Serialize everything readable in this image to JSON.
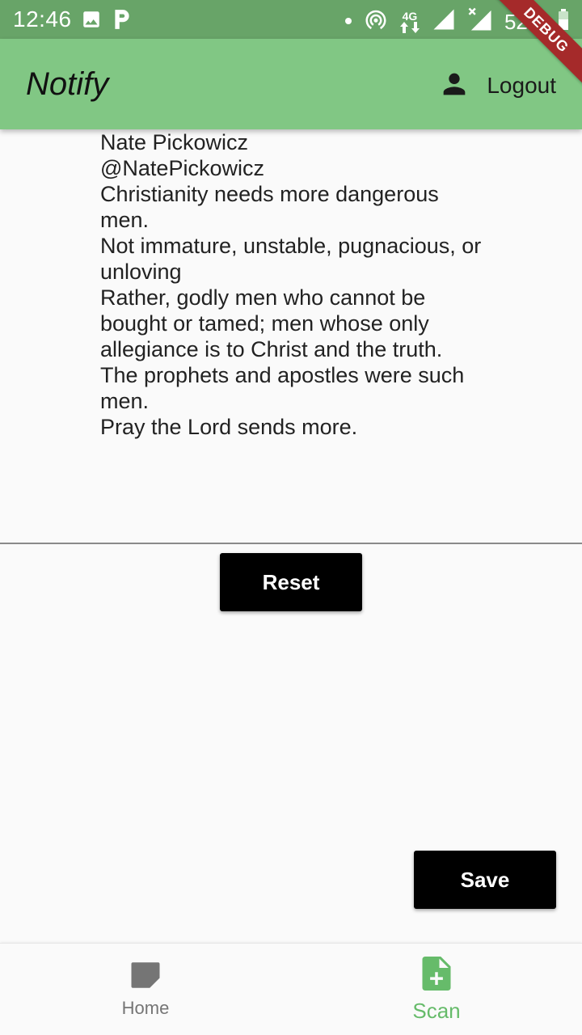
{
  "status_bar": {
    "time": "12:46",
    "network": "4G",
    "battery": "52%",
    "icons": [
      "image-icon",
      "parking-icon",
      "dot-icon",
      "hotspot-icon",
      "data-arrows-icon",
      "signal-icon",
      "signal-x-icon",
      "battery-icon"
    ]
  },
  "debug_banner": "DEBUG",
  "app_bar": {
    "title": "Notify",
    "logout_label": "Logout",
    "logout_icon": "person-icon"
  },
  "scan_result": {
    "lines": [
      "Nate Pickowicz",
      "@NatePickowicz",
      "Christianity needs more dangerous men.",
      "Not immature, unstable, pugnacious, or unloving",
      "Rather, godly men who cannot be bought or tamed; men whose only allegiance is to Christ and the truth.",
      "The prophets and apostles were such men.",
      "Pray the Lord sends more."
    ]
  },
  "actions": {
    "reset_label": "Reset",
    "save_label": "Save"
  },
  "bottom_nav": {
    "items": [
      {
        "label": "Home",
        "icon": "note-icon",
        "active": false
      },
      {
        "label": "Scan",
        "icon": "add-file-icon",
        "active": true
      }
    ]
  },
  "colors": {
    "status_bar": "#68a468",
    "app_bar": "#81c784",
    "accent": "#66bb6a",
    "button": "#000000",
    "debug": "#a52a2a"
  }
}
